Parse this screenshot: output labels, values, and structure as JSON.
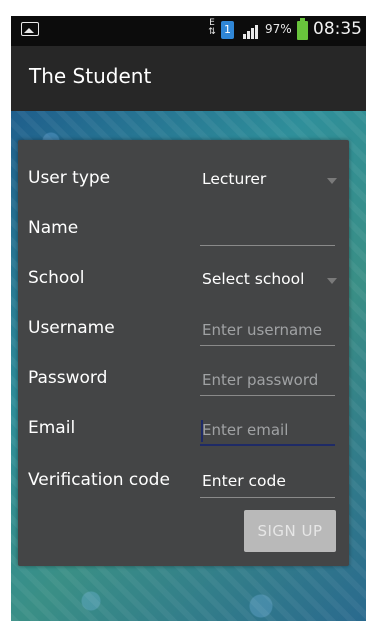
{
  "status_bar": {
    "carrier_letter": "E",
    "sim_number": "1",
    "battery_percent": "97%",
    "time": "08:35"
  },
  "app_bar": {
    "title": "The Student"
  },
  "form": {
    "user_type": {
      "label": "User type",
      "value": "Lecturer"
    },
    "name": {
      "label": "Name",
      "value": ""
    },
    "school": {
      "label": "School",
      "value": "Select school"
    },
    "username": {
      "label": "Username",
      "placeholder": "Enter username"
    },
    "password": {
      "label": "Password",
      "placeholder": "Enter password"
    },
    "email": {
      "label": "Email",
      "placeholder": "Enter email"
    },
    "verification_code": {
      "label": "Verification code",
      "placeholder": "Enter code"
    },
    "signup_button": "SIGN UP"
  },
  "colors": {
    "app_bar": "#272727",
    "card": "#444546",
    "button_disabled": "#b9b9b9",
    "focus_underline": "#1e2a66"
  }
}
